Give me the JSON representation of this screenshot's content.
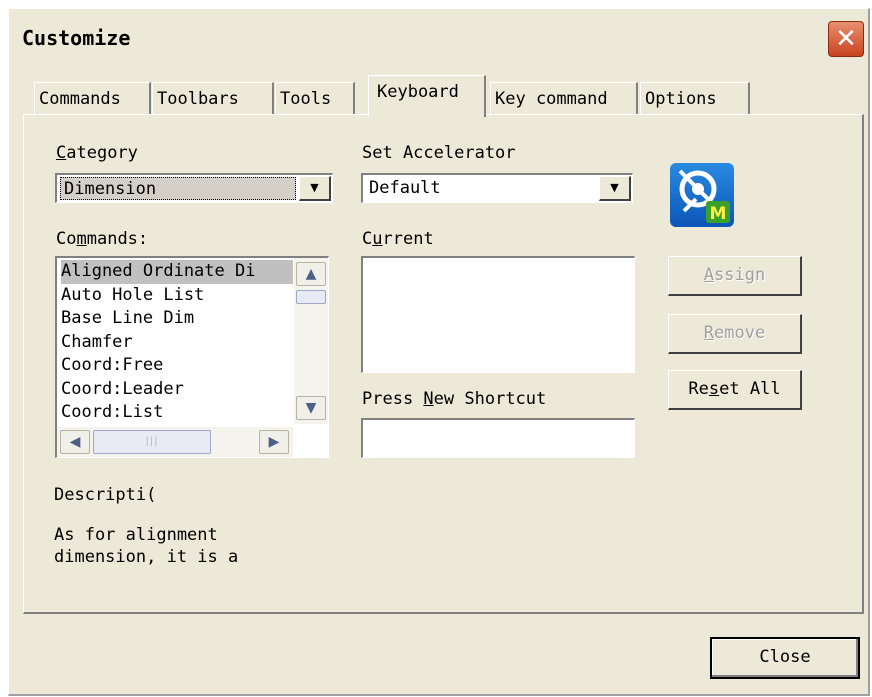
{
  "window": {
    "title": "Customize",
    "close_glyph": "✕"
  },
  "tabs": [
    {
      "label": "Commands"
    },
    {
      "label": "Toolbars"
    },
    {
      "label": "Tools"
    },
    {
      "label": "Keyboard",
      "active": true
    },
    {
      "label": "Key command"
    },
    {
      "label": "Options"
    }
  ],
  "category": {
    "label_u": "C",
    "label_rest": "ategory",
    "value": "Dimension"
  },
  "commands": {
    "label_pre": "Co",
    "label_u": "m",
    "label_rest": "mands:",
    "items": [
      "Aligned Ordinate Di",
      "Auto Hole List",
      "Base Line Dim",
      "Chamfer",
      "Coord:Free",
      "Coord:Leader",
      "Coord:List"
    ],
    "selected_index": 0
  },
  "accelerator": {
    "label": "Set Accelerator",
    "value": "Default"
  },
  "current": {
    "label_pre": "C",
    "label_u": "u",
    "label_rest": "rrent"
  },
  "shortcut": {
    "label_pre": "Press ",
    "label_u": "N",
    "label_rest": "ew Shortcut"
  },
  "buttons": {
    "assign_u": "A",
    "assign_rest": "ssign",
    "remove_u": "R",
    "remove_rest": "emove",
    "reset_pre": "Re",
    "reset_u": "s",
    "reset_rest": "et All",
    "close": "Close"
  },
  "description": {
    "label": "Descripti(",
    "lines": [
      "As for alignment",
      "dimension, it is a"
    ]
  },
  "icons": {
    "logo": "app-logo-icon",
    "scroll_up": "▲",
    "scroll_down": "▼",
    "scroll_left": "◀",
    "scroll_right": "▶",
    "dropdown": "▼",
    "grip": "|||"
  }
}
